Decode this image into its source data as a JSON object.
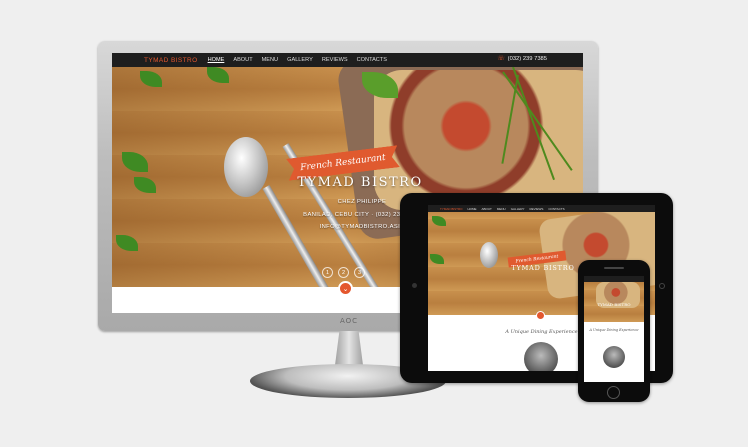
{
  "site": {
    "brand": "TYMAD BISTRO",
    "nav": [
      "HOME",
      "ABOUT",
      "MENU",
      "GALLERY",
      "REVIEWS",
      "CONTACTS"
    ],
    "phone": "(032) 239 7385",
    "phone_icon": "phone-icon"
  },
  "hero": {
    "ribbon": "French Restaurant",
    "title": "TYMAD BISTRO",
    "chef": "CHEZ PHILIPPE",
    "address": "BANILAD, CEBU CITY · (032) 239-7385",
    "email": "INFO@TYMADBISTRO.ASIA",
    "slides": [
      "1",
      "2",
      "3"
    ],
    "down_icon": "chevron-down-icon"
  },
  "monitor": {
    "logo": "AOC"
  },
  "tablet": {
    "tagline": "A Unique Dining Experience"
  },
  "phone_device": {
    "tagline": "A Unique Dining Experience"
  },
  "accent_color": "#e4572e"
}
